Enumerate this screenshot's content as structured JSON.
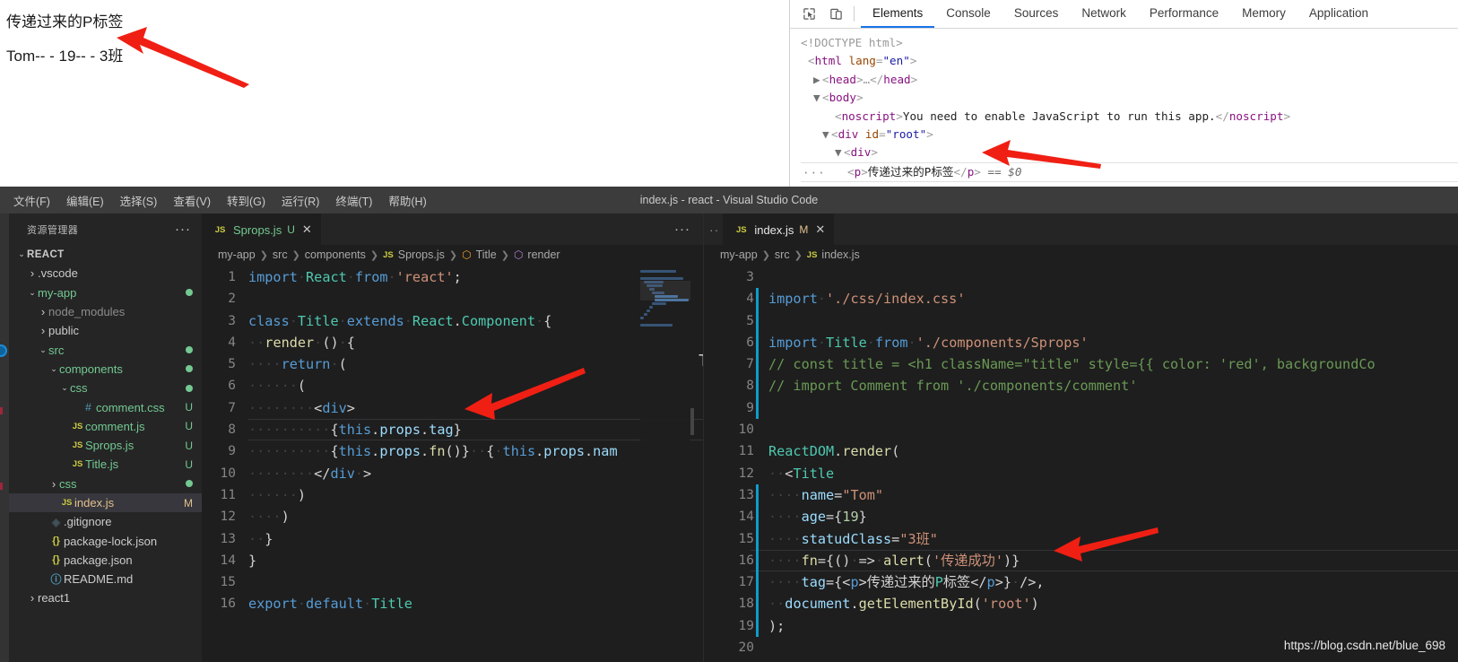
{
  "browser_page": {
    "line1": "传递过来的P标签",
    "line2": "Tom-- - 19-- - 3班"
  },
  "devtools": {
    "toolbar_icons": [
      "inspect-element-icon",
      "device-toolbar-icon"
    ],
    "tabs": [
      {
        "label": "Elements",
        "active": true
      },
      {
        "label": "Console",
        "active": false
      },
      {
        "label": "Sources",
        "active": false
      },
      {
        "label": "Network",
        "active": false
      },
      {
        "label": "Performance",
        "active": false
      },
      {
        "label": "Memory",
        "active": false
      },
      {
        "label": "Application",
        "active": false
      }
    ],
    "dom_rows": [
      {
        "indent": 0,
        "twisty": "",
        "text": "<!DOCTYPE html>",
        "kind": "doctype"
      },
      {
        "indent": 0,
        "twisty": "",
        "text": "<html lang=\"en\">",
        "kind": "tag-attr"
      },
      {
        "indent": 0,
        "twisty": "collapsed",
        "text": "<head>…</head>",
        "kind": "tag"
      },
      {
        "indent": 0,
        "twisty": "expanded",
        "text": "<body>",
        "kind": "tag"
      },
      {
        "indent": 1,
        "twisty": "",
        "text": "<noscript>You need to enable JavaScript to run this app.</noscript>",
        "kind": "tag-text"
      },
      {
        "indent": 1,
        "twisty": "expanded",
        "text": "<div id=\"root\">",
        "kind": "tag-attr"
      },
      {
        "indent": 2,
        "twisty": "expanded",
        "text": "<div>",
        "kind": "tag"
      },
      {
        "indent": 3,
        "twisty": "",
        "text": "<p>传递过来的P标签</p> == $0",
        "kind": "selected"
      }
    ],
    "selected_suffix": "== $0",
    "overflow_dots": "···"
  },
  "vscode": {
    "menu": [
      "文件(F)",
      "编辑(E)",
      "选择(S)",
      "查看(V)",
      "转到(G)",
      "运行(R)",
      "终端(T)",
      "帮助(H)"
    ],
    "window_title": "index.js - react - Visual Studio Code",
    "sidebar": {
      "header": "资源管理器",
      "header_actions": "···",
      "tree": [
        {
          "label": "REACT",
          "depth": 0,
          "twisty": "expanded",
          "icon": "",
          "status": "",
          "style": "folder-bold"
        },
        {
          "label": ".vscode",
          "depth": 1,
          "twisty": "collapsed",
          "icon": "",
          "status": "",
          "style": "plain"
        },
        {
          "label": "my-app",
          "depth": 1,
          "twisty": "expanded",
          "icon": "",
          "status": "dot",
          "style": "green"
        },
        {
          "label": "node_modules",
          "depth": 2,
          "twisty": "collapsed",
          "icon": "",
          "status": "",
          "style": "dim"
        },
        {
          "label": "public",
          "depth": 2,
          "twisty": "collapsed",
          "icon": "",
          "status": "",
          "style": "plain"
        },
        {
          "label": "src",
          "depth": 2,
          "twisty": "expanded",
          "icon": "",
          "status": "dot",
          "style": "green"
        },
        {
          "label": "components",
          "depth": 3,
          "twisty": "expanded",
          "icon": "",
          "status": "dot",
          "style": "green"
        },
        {
          "label": "css",
          "depth": 4,
          "twisty": "expanded",
          "icon": "",
          "status": "dot",
          "style": "green"
        },
        {
          "label": "comment.css",
          "depth": 5,
          "twisty": "",
          "icon": "css",
          "status": "U",
          "style": "green"
        },
        {
          "label": "comment.js",
          "depth": 4,
          "twisty": "",
          "icon": "js",
          "status": "U",
          "style": "green"
        },
        {
          "label": "Sprops.js",
          "depth": 4,
          "twisty": "",
          "icon": "js",
          "status": "U",
          "style": "green"
        },
        {
          "label": "Title.js",
          "depth": 4,
          "twisty": "",
          "icon": "js",
          "status": "U",
          "style": "green"
        },
        {
          "label": "css",
          "depth": 3,
          "twisty": "collapsed",
          "icon": "",
          "status": "dot",
          "style": "green"
        },
        {
          "label": "index.js",
          "depth": 3,
          "twisty": "",
          "icon": "js",
          "status": "M",
          "style": "mod",
          "selected": true
        },
        {
          "label": ".gitignore",
          "depth": 2,
          "twisty": "",
          "icon": "git",
          "status": "",
          "style": "plain"
        },
        {
          "label": "package-lock.json",
          "depth": 2,
          "twisty": "",
          "icon": "json",
          "status": "",
          "style": "plain"
        },
        {
          "label": "package.json",
          "depth": 2,
          "twisty": "",
          "icon": "json",
          "status": "",
          "style": "plain"
        },
        {
          "label": "README.md",
          "depth": 2,
          "twisty": "",
          "icon": "md",
          "status": "",
          "style": "plain"
        },
        {
          "label": "react1",
          "depth": 1,
          "twisty": "collapsed",
          "icon": "",
          "status": "",
          "style": "plain"
        }
      ]
    },
    "editor_left": {
      "tab": {
        "icon": "js-file-icon",
        "name": "Sprops.js",
        "badge": "U",
        "close": "✕"
      },
      "tab_actions": "···",
      "breadcrumb": [
        "my-app",
        "src",
        "components",
        "Sprops.js",
        "Title",
        "render"
      ],
      "first_line_number": 1,
      "lines": [
        "import React from 'react';",
        "",
        "class Title extends React.Component {",
        "  render () {",
        "    return (",
        "      (",
        "        <div>",
        "          {this.props.tag}",
        "          {this.props.fn()}  { this.props.nam",
        "        </div >",
        "      )",
        "    )",
        "  }",
        "}",
        "",
        "export default Title"
      ],
      "cursor_line": 8
    },
    "editor_right": {
      "tab": {
        "icon": "js-file-icon",
        "name": "index.js",
        "badge": "M",
        "close": "✕"
      },
      "breadcrumb": [
        "my-app",
        "src",
        "index.js"
      ],
      "first_line_number": 3,
      "lines": [
        "",
        "import './css/index.css'",
        "",
        "import Title from './components/Sprops'",
        "// const title = <h1 className=\"title\" style={{ color: 'red', backgroundCo",
        "// import Comment from './components/comment'",
        "",
        "",
        "ReactDOM.render(",
        "  <Title",
        "    name=\"Tom\"",
        "    age={19}",
        "    statudClass=\"3班\"",
        "    fn={() => alert('传递成功')}",
        "    tag={<p>传递过来的P标签</p>} />,",
        "  document.getElementById('root')",
        ");",
        ""
      ],
      "cursor_line": 16
    },
    "watermark": "https://blog.csdn.net/blue_698"
  }
}
